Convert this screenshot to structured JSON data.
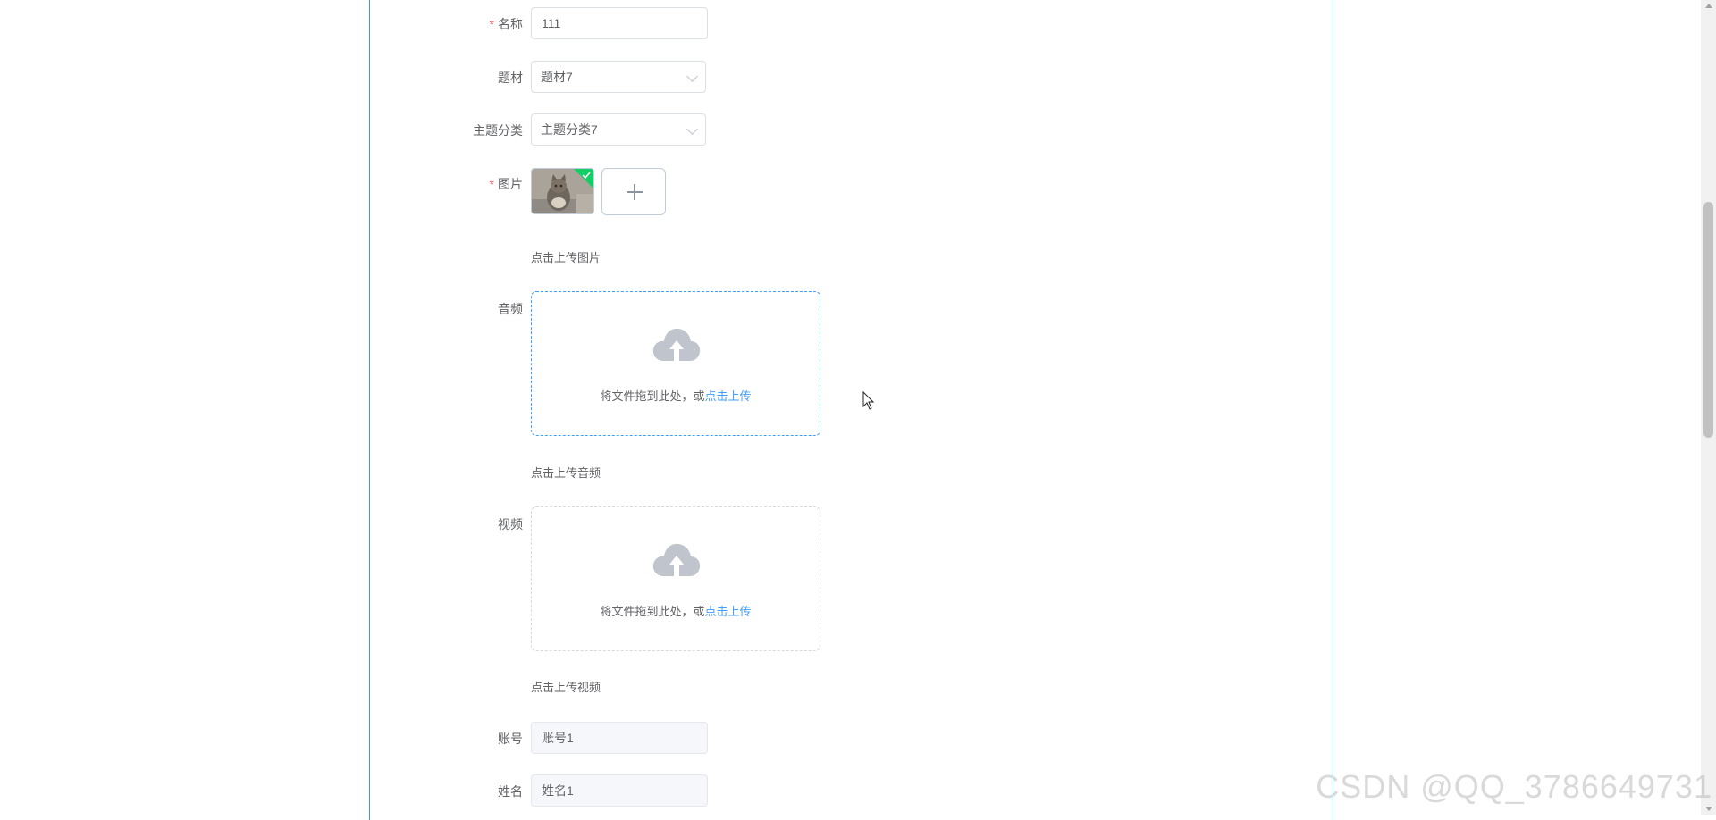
{
  "form": {
    "name": {
      "label": "名称",
      "required": "*",
      "value": "111"
    },
    "subject": {
      "label": "题材",
      "value": "题材7"
    },
    "theme_category": {
      "label": "主题分类",
      "value": "主题分类7"
    },
    "image": {
      "label": "图片",
      "required": "*",
      "tip": "点击上传图片"
    },
    "audio": {
      "label": "音频",
      "drag_text": "将文件拖到此处，或",
      "drag_link": "点击上传",
      "tip": "点击上传音频"
    },
    "video": {
      "label": "视频",
      "drag_text": "将文件拖到此处，或",
      "drag_link": "点击上传",
      "tip": "点击上传视频"
    },
    "account": {
      "label": "账号",
      "value": "账号1"
    },
    "real_name": {
      "label": "姓名",
      "value": "姓名1"
    }
  },
  "icons": {
    "upload_success": "check-icon",
    "upload_add": "plus-icon",
    "upload_cloud": "cloud-upload-icon",
    "select_arrow": "chevron-down-icon"
  },
  "colors": {
    "accent": "#409eff",
    "required": "#f56c6c",
    "success": "#13ce66",
    "panel_border": "#3a9fd6"
  },
  "watermark": "CSDN @QQ_3786649731"
}
